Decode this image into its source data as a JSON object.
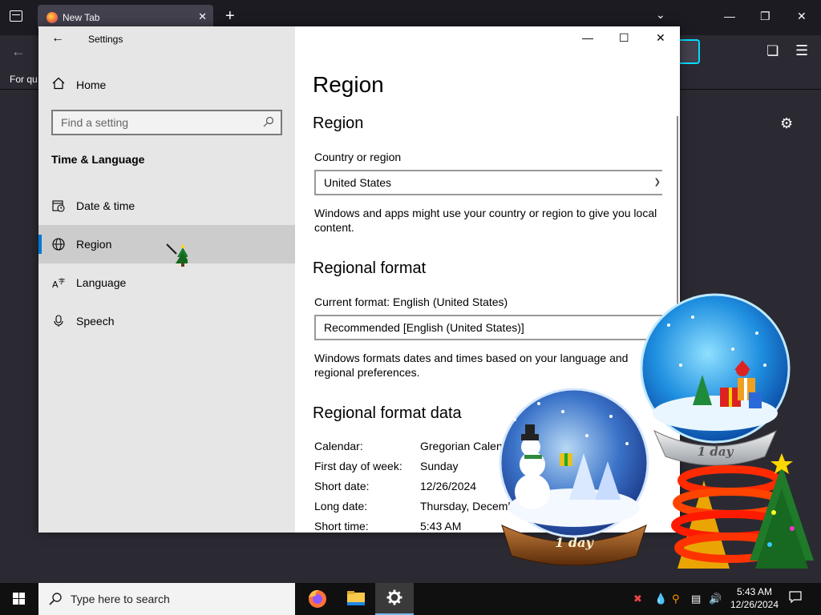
{
  "browser": {
    "tab_title": "New Tab",
    "tab_close": "✕",
    "new_tab": "+",
    "bookmarks_text": "For qu",
    "window_controls": [
      "—",
      "❐",
      "✕"
    ]
  },
  "settings": {
    "app_title": "Settings",
    "home_label": "Home",
    "search_placeholder": "Find a setting",
    "section_title": "Time & Language",
    "nav_items": [
      {
        "label": "Date & time",
        "icon": "calendar-clock-icon"
      },
      {
        "label": "Region",
        "icon": "globe-icon",
        "active": true
      },
      {
        "label": "Language",
        "icon": "language-icon"
      },
      {
        "label": "Speech",
        "icon": "microphone-icon"
      }
    ],
    "window_controls": [
      "—",
      "☐",
      "✕"
    ],
    "page_title": "Region",
    "region_heading": "Region",
    "country_label": "Country or region",
    "country_value": "United States",
    "country_desc": "Windows and apps might use your country or region to give you local content.",
    "format_heading": "Regional format",
    "current_format_label": "Current format: English (United States)",
    "format_value": "Recommended [English (United States)]",
    "format_desc": "Windows formats dates and times based on your language and regional preferences.",
    "format_data_heading": "Regional format data",
    "format_data": [
      {
        "key": "Calendar:",
        "value": "Gregorian Calendar"
      },
      {
        "key": "First day of week:",
        "value": "Sunday"
      },
      {
        "key": "Short date:",
        "value": "12/26/2024"
      },
      {
        "key": "Long date:",
        "value": "Thursday, December 26, 2024"
      },
      {
        "key": "Short time:",
        "value": "5:43 AM"
      }
    ]
  },
  "decorations": {
    "globe_label_1": "1 day",
    "globe_label_2": "1 day"
  },
  "taskbar": {
    "search_placeholder": "Type here to search",
    "time": "5:43 AM",
    "date": "12/26/2024"
  },
  "colors": {
    "accent": "#0078d7",
    "sidebar_bg": "#e6e6e6",
    "active_item_bg": "#cccccc",
    "taskbar_bg": "#101010",
    "firefox_bg": "#1c1b22"
  }
}
